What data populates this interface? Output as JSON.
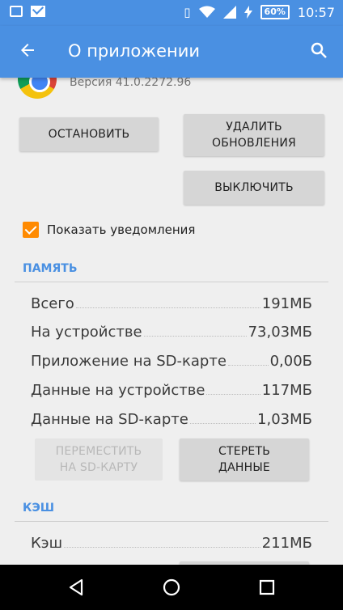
{
  "status_bar": {
    "time": "10:57",
    "battery": "60%",
    "icons": [
      "image-icon",
      "mail-icon",
      "vibrate-icon",
      "wifi-icon",
      "signal-icon",
      "charging-icon"
    ]
  },
  "app_bar": {
    "title": "О приложении",
    "back_icon": "back-arrow-icon",
    "search_icon": "search-icon"
  },
  "app": {
    "version": "Версия 41.0.2272.96"
  },
  "buttons": {
    "stop": "ОСТАНОВИТЬ",
    "uninstall_updates": "УДАЛИТЬ ОБНОВЛЕНИЯ",
    "disable": "ВЫКЛЮЧИТЬ"
  },
  "notifications": {
    "label": "Показать уведомления",
    "checked": true
  },
  "memory": {
    "header": "ПАМЯТЬ",
    "rows": [
      {
        "label": "Всего",
        "value": "191МБ"
      },
      {
        "label": "На устройстве",
        "value": "73,03МБ"
      },
      {
        "label": "Приложение на SD-карте",
        "value": "0,00Б"
      },
      {
        "label": "Данные на устройстве",
        "value": "117МБ"
      },
      {
        "label": "Данные на SD-карте",
        "value": "1,03МБ"
      }
    ],
    "move_button": "ПЕРЕМЕСТИТЬ НА SD-КАРТУ",
    "clear_data_button": "СТЕРЕТЬ ДАННЫЕ"
  },
  "cache": {
    "header": "КЭШ",
    "rows": [
      {
        "label": "Кэш",
        "value": "211МБ"
      }
    ]
  },
  "nav_bar": {
    "icons": [
      "back-triangle-icon",
      "home-circle-icon",
      "recents-square-icon"
    ]
  },
  "colors": {
    "accent": "#4a90e2",
    "checkbox": "#ff8a00"
  }
}
